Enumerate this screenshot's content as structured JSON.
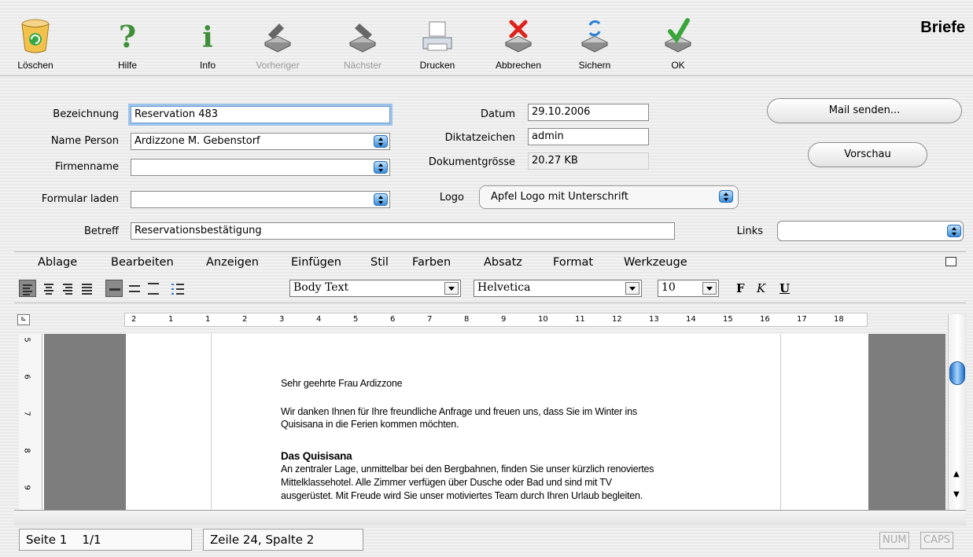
{
  "window": {
    "title": "Briefe"
  },
  "toolbar": {
    "delete": "Löschen",
    "help": "Hilfe",
    "info": "Info",
    "previous": "Vorheriger",
    "next": "Nächster",
    "print": "Drucken",
    "cancel": "Abbrechen",
    "save": "Sichern",
    "ok": "OK"
  },
  "form": {
    "bezeichnung_label": "Bezeichnung",
    "bezeichnung_value": "Reservation  483",
    "name_person_label": "Name Person",
    "name_person_value": "Ardizzone M. Gebenstorf",
    "firmenname_label": "Firmenname",
    "firmenname_value": "",
    "formular_label": "Formular laden",
    "formular_value": "",
    "betreff_label": "Betreff",
    "betreff_value": "Reservationsbestätigung",
    "datum_label": "Datum",
    "datum_value": "29.10.2006",
    "diktat_label": "Diktatzeichen",
    "diktat_value": "admin",
    "groesse_label": "Dokumentgrösse",
    "groesse_value": "20.27 KB",
    "logo_label": "Logo",
    "logo_value": "Apfel Logo mit Unterschrift",
    "links_label": "Links",
    "links_value": "",
    "mail_button": "Mail senden...",
    "preview_button": "Vorschau"
  },
  "editor_menu": [
    "Ablage",
    "Bearbeiten",
    "Anzeigen",
    "Einfügen",
    "Stil",
    "Farben",
    "Absatz",
    "Format",
    "Werkzeuge"
  ],
  "format": {
    "style": "Body Text",
    "font": "Helvetica",
    "size": "10",
    "bold": "F",
    "italic": "K",
    "underline": "U"
  },
  "ruler": {
    "h_ticks": [
      "2",
      "1",
      "1",
      "2",
      "3",
      "4",
      "5",
      "6",
      "7",
      "8",
      "9",
      "10",
      "11",
      "12",
      "13",
      "14",
      "15",
      "16",
      "17",
      "18"
    ],
    "v_ticks": [
      "5",
      "6",
      "7",
      "8",
      "9"
    ]
  },
  "document": {
    "salutation": "Sehr geehrte Frau Ardizzone",
    "para1_line1": "Wir danken Ihnen für Ihre freundliche Anfrage und freuen uns, dass Sie im Winter ins",
    "para1_line2": "Quisisana in die Ferien kommen möchten.",
    "heading": "Das Quisisana",
    "para2_line1": "An zentraler Lage, unmittelbar bei den Bergbahnen, finden Sie unser kürzlich renoviertes",
    "para2_line2": "Mittelklassehotel. Alle Zimmer verfügen über Dusche oder Bad und sind mit TV",
    "para2_line3": "ausgerüstet. Mit Freude wird Sie unser motiviertes Team durch Ihren Urlaub begleiten."
  },
  "status": {
    "page": "Seite 1",
    "page_count": "1/1",
    "position": "Zeile 24, Spalte 2",
    "num": "NUM",
    "caps": "CAPS"
  }
}
